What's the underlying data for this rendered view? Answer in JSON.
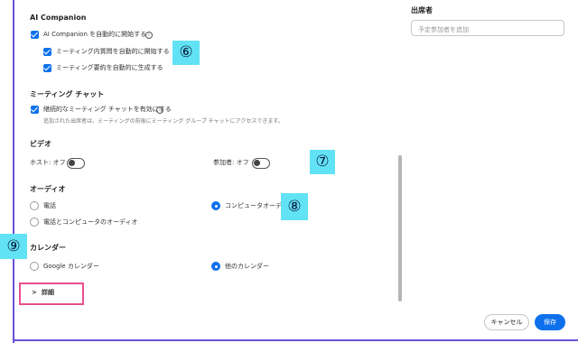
{
  "ai_companion": {
    "heading": "AI Companion",
    "auto_start_label": "AI Companion を自動的に開始する",
    "info_glyph": "i",
    "questions_label": "ミーティング内質問を自動的に開始する",
    "summary_label": "ミーティング要約を自動的に生成する"
  },
  "meeting_chat": {
    "heading": "ミーティング チャット",
    "continuous_label": "継続的なミーティング チャットを有効にする",
    "info_glyph": "i",
    "note": "追加された出席者は、ミーティングの前後にミーティング グループ チャットにアクセスできます。"
  },
  "video": {
    "heading": "ビデオ",
    "host_label": "ホスト: オフ",
    "participant_label": "参加者: オフ",
    "host_on": false,
    "participant_on": false
  },
  "audio": {
    "heading": "オーディオ",
    "options": [
      "電話",
      "コンピュータオーディオ",
      "電話とコンピュータのオーディオ"
    ],
    "selected": "コンピュータオーディオ"
  },
  "calendar": {
    "heading": "カレンダー",
    "options": [
      "Google カレンダー",
      "他のカレンダー"
    ],
    "selected": "他のカレンダー"
  },
  "details": {
    "chevron": ">",
    "label": "詳細"
  },
  "attendees": {
    "heading": "出席者",
    "placeholder": "予定参加者を追加"
  },
  "footer": {
    "cancel_label": "キャンセル",
    "save_label": "保存"
  },
  "annotations": [
    "⑥",
    "⑦",
    "⑧",
    "⑨"
  ],
  "colors": {
    "accent": "#0e71eb",
    "frame": "#6b4fd8",
    "badge": "#62e2f5",
    "highlight": "#e8508f"
  }
}
